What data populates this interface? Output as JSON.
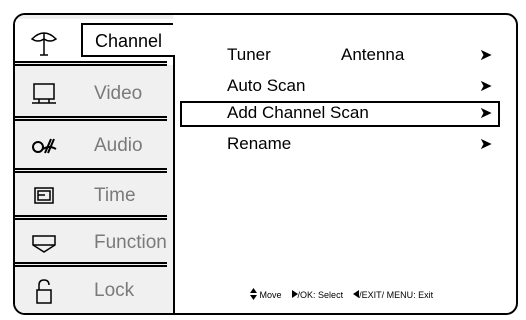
{
  "sidebar": {
    "items": [
      {
        "label": "Channel",
        "icon": "antenna-icon",
        "active": true
      },
      {
        "label": "Video",
        "icon": "monitor-icon"
      },
      {
        "label": "Audio",
        "icon": "audio-icon"
      },
      {
        "label": "Time",
        "icon": "time-icon"
      },
      {
        "label": "Function",
        "icon": "function-icon"
      },
      {
        "label": "Lock",
        "icon": "lock-icon"
      }
    ]
  },
  "menu": {
    "rows": [
      {
        "label": "Tuner",
        "value": "Antenna",
        "arrow": "➤"
      },
      {
        "label": "Auto Scan",
        "value": "",
        "arrow": "➤"
      },
      {
        "label": "Add Channel Scan",
        "value": "",
        "arrow": "➤",
        "selected": true
      },
      {
        "label": "Rename",
        "value": "",
        "arrow": "➤"
      }
    ]
  },
  "footer": {
    "move": "Move",
    "select": "/OK: Select",
    "exit": "/EXIT/ MENU: Exit"
  }
}
